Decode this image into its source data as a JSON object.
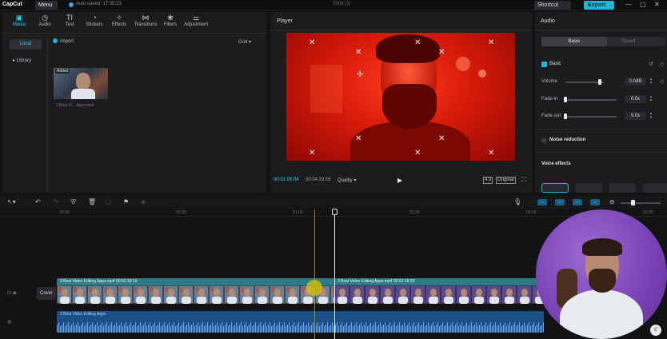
{
  "titlebar": {
    "app_name": "CapCut",
    "menu_label": "Menu",
    "autosave": "Auto saved: 17:35:23",
    "project_name": "0906 (3)",
    "shortcut_label": "Shortcut",
    "export_label": "Export",
    "window_buttons": [
      "—",
      "▢",
      "✕"
    ]
  },
  "media": {
    "tabs": [
      {
        "label": "Media",
        "icon": "media-icon",
        "glyph": "▣",
        "active": true
      },
      {
        "label": "Audio",
        "icon": "audio-icon",
        "glyph": "◷",
        "active": false
      },
      {
        "label": "Text",
        "icon": "text-icon",
        "glyph": "TI",
        "active": false
      },
      {
        "label": "Stickers",
        "icon": "stickers-icon",
        "glyph": "◔",
        "active": false
      },
      {
        "label": "Effects",
        "icon": "effects-icon",
        "glyph": "✧",
        "active": false
      },
      {
        "label": "Transitions",
        "icon": "transitions-icon",
        "glyph": "⋈",
        "active": false
      },
      {
        "label": "Filters",
        "icon": "filters-icon",
        "glyph": "❀",
        "active": false
      },
      {
        "label": "Adjustment",
        "icon": "adjustment-icon",
        "glyph": "⚌",
        "active": false
      }
    ],
    "sidebar": {
      "local": "Local",
      "library": "▸ Library"
    },
    "import_label": "Import",
    "grid_label": "Grid ▾",
    "thumb_badge": "Added",
    "thumb_name": "3 Best Vi... Apps.mp4",
    "accent": "#2fd0ef"
  },
  "player": {
    "title": "Player",
    "current_time": "00:01:06:04",
    "total_time": "00:04:29:06",
    "quality": "Quality ▾",
    "play_glyph": "▶",
    "ratio_label": "4:3",
    "original_label": "Original",
    "fullscreen_glyph": "⛶"
  },
  "audio": {
    "title": "Audio",
    "seg_basic": "Basic",
    "seg_speed": "Speed",
    "basic_label": "Basic",
    "volume_label": "Volume",
    "volume_value": "0.0dB",
    "volume_level": 0.9,
    "fadein_label": "Fade-in",
    "fadein_value": "0.0s",
    "fadeout_label": "Fade-out",
    "fadeout_value": "0.0s",
    "noise_label": "Noise reduction",
    "voice_label": "Voice effects"
  },
  "timeline": {
    "ruler": [
      "00:00",
      "00:30",
      "01:00",
      "01:30",
      "02:00",
      "02:30"
    ],
    "cover_label": "Cover",
    "clip1_label": "3 Best Video Editing Apps.mp4   00:01:10:16",
    "clip2_label": "3 Best Video Editing Apps.mp4   00:01:18:20",
    "audio_clip_label": "3 Best Video Editing Apps",
    "zoom_level": 0.3
  }
}
